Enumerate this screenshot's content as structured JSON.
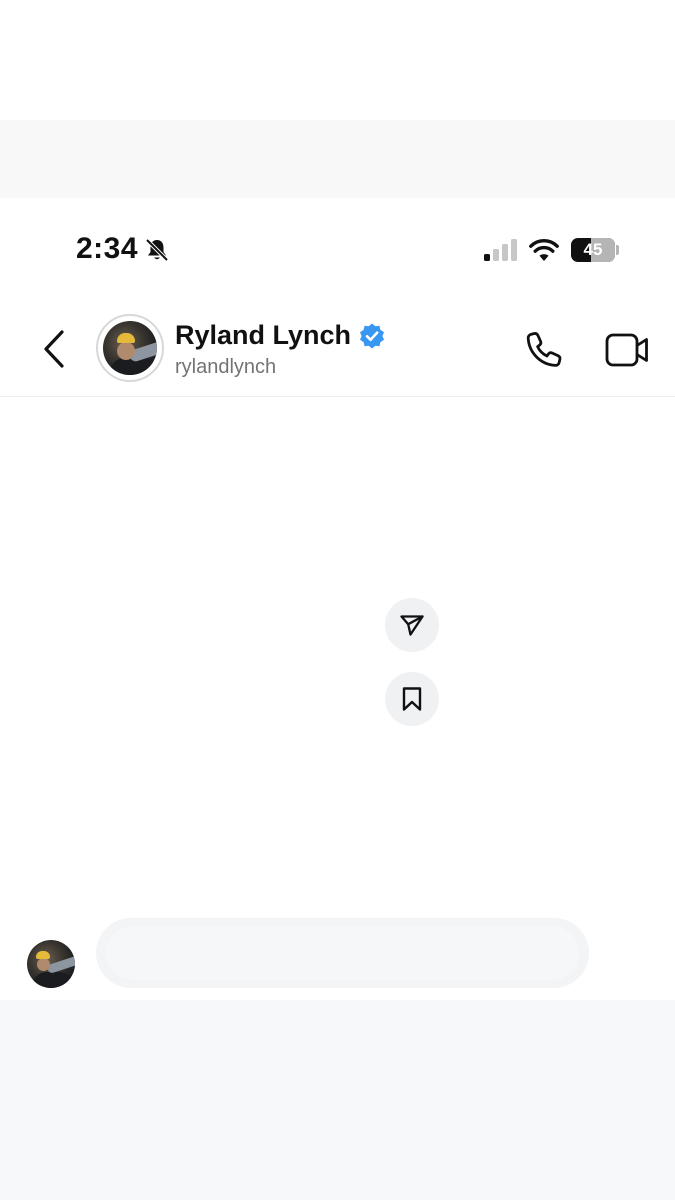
{
  "status_bar": {
    "time": "2:34",
    "battery_level": "45",
    "mute_icon": "bell-slash-icon",
    "signal_icon": "cellular-signal-icon",
    "wifi_icon": "wifi-icon"
  },
  "header": {
    "back_icon": "chevron-left-icon",
    "contact_name": "Ryland Lynch",
    "contact_handle": "rylandlynch",
    "verified_icon": "verified-badge-icon",
    "call_icon": "phone-icon",
    "video_icon": "video-camera-icon"
  },
  "actions": {
    "share_icon": "send-icon",
    "save_icon": "bookmark-icon"
  },
  "colors": {
    "verified_blue": "#3897f0",
    "icon_dark": "#111111",
    "handle_gray": "#737373",
    "bubble_gray": "#f3f4f6"
  }
}
